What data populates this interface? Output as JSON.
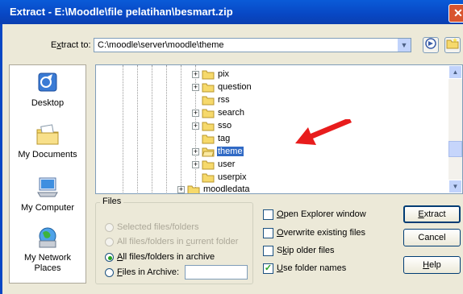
{
  "window": {
    "title": "Extract - E:\\Moodle\\file pelatihan\\besmart.zip",
    "close_glyph": "✕"
  },
  "extract_to": {
    "label_pre": "E",
    "label_u": "x",
    "label_post": "tract to:",
    "value": "C:\\moodle\\server\\moodle\\theme",
    "dropdown_glyph": "▼"
  },
  "places": [
    {
      "label": "Desktop",
      "icon": "desktop-icon"
    },
    {
      "label": "My Documents",
      "icon": "my-documents-icon"
    },
    {
      "label": "My Computer",
      "icon": "my-computer-icon"
    },
    {
      "label": "My Network Places",
      "icon": "network-places-icon"
    }
  ],
  "tree": {
    "items": [
      {
        "name": "pix",
        "expandable": true
      },
      {
        "name": "question",
        "expandable": true
      },
      {
        "name": "rss",
        "expandable": false
      },
      {
        "name": "search",
        "expandable": true
      },
      {
        "name": "sso",
        "expandable": true
      },
      {
        "name": "tag",
        "expandable": false
      },
      {
        "name": "theme",
        "expandable": true,
        "selected": true
      },
      {
        "name": "user",
        "expandable": true
      },
      {
        "name": "userpix",
        "expandable": false
      },
      {
        "name": "moodledata",
        "expandable": true
      }
    ],
    "expand_glyph": "+",
    "scroll_up": "▲",
    "scroll_down": "▼"
  },
  "files_group": {
    "title": "Files",
    "options": [
      {
        "label": "Selected files/folders",
        "enabled": false,
        "checked": false
      },
      {
        "pre": "All files/folders in ",
        "u": "c",
        "post": "urrent folder",
        "enabled": false,
        "checked": false
      },
      {
        "pre": "",
        "u": "A",
        "post": "ll files/folders in archive",
        "enabled": true,
        "checked": true
      },
      {
        "pre": "",
        "u": "F",
        "post": "iles in Archive:",
        "enabled": true,
        "checked": false
      }
    ],
    "files_in_archive_value": ""
  },
  "options": [
    {
      "pre": "",
      "u": "O",
      "post": "pen Explorer window",
      "checked": false
    },
    {
      "pre": "",
      "u": "O",
      "post": "verwrite existing files",
      "checked": false
    },
    {
      "pre": "S",
      "u": "k",
      "post": "ip older files",
      "checked": false
    },
    {
      "pre": "",
      "u": "U",
      "post": "se folder names",
      "checked": true
    }
  ],
  "check_glyph": "✓",
  "buttons": {
    "extract": {
      "u": "E",
      "post": "xtract"
    },
    "cancel": {
      "label": "Cancel"
    },
    "help": {
      "u": "H",
      "post": "elp"
    }
  },
  "colors": {
    "title_bar": "#0847c4",
    "selection": "#316ac5",
    "arrow": "#e81c1c",
    "dialog_bg": "#ece9d8"
  }
}
